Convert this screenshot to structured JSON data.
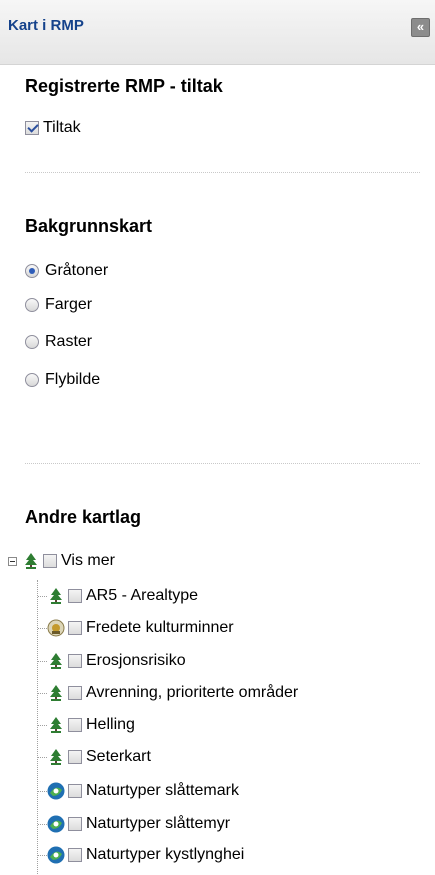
{
  "header": {
    "title": "Kart i RMP",
    "collapse_label": "«"
  },
  "registered": {
    "heading": "Registrerte RMP - tiltak",
    "checkbox": {
      "label": "Tiltak",
      "checked": true
    }
  },
  "background": {
    "heading": "Bakgrunnskart",
    "options": [
      {
        "label": "Gråtoner",
        "selected": true
      },
      {
        "label": "Farger",
        "selected": false
      },
      {
        "label": "Raster",
        "selected": false
      },
      {
        "label": "Flybilde",
        "selected": false
      }
    ]
  },
  "other_layers": {
    "heading": "Andre kartlag",
    "root": {
      "label": "Vis mer",
      "icon": "tree-icon",
      "checked": false,
      "expanded": true
    },
    "items": [
      {
        "label": "AR5 - Arealtype",
        "icon": "tree-icon",
        "checked": false
      },
      {
        "label": "Fredete kulturminner",
        "icon": "heritage-icon",
        "checked": false
      },
      {
        "label": "Erosjonsrisiko",
        "icon": "tree-icon",
        "checked": false
      },
      {
        "label": "Avrenning, prioriterte områder",
        "icon": "tree-icon",
        "checked": false
      },
      {
        "label": "Helling",
        "icon": "tree-icon",
        "checked": false
      },
      {
        "label": "Seterkart",
        "icon": "tree-icon",
        "checked": false
      },
      {
        "label": "Naturtyper slåttemark",
        "icon": "nature-type-icon",
        "checked": false
      },
      {
        "label": "Naturtyper slåttemyr",
        "icon": "nature-type-icon",
        "checked": false
      },
      {
        "label": "Naturtyper kystlynghei",
        "icon": "nature-type-icon",
        "checked": false
      }
    ]
  },
  "colors": {
    "header_text": "#15428b",
    "tree_icon": "#2e7d32",
    "nature_icon": "#1f6fb2"
  }
}
